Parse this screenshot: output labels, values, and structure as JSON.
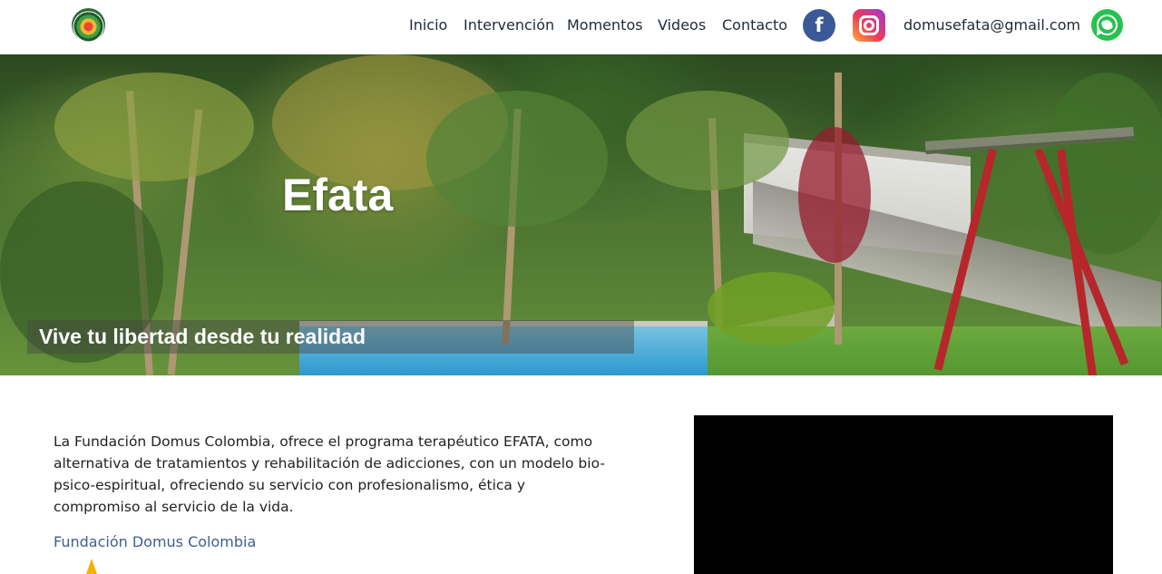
{
  "header": {
    "logo_icon": "domus-colombia-logo",
    "nav": [
      "Inicio",
      "Intervención",
      "Momentos",
      "Videos",
      "Contacto"
    ],
    "facebook_icon": "facebook-icon",
    "instagram_icon": "instagram-icon",
    "email": "domusefata@gmail.com",
    "whatsapp_icon": "whatsapp-icon",
    "colors": {
      "facebook": "#3b5998",
      "whatsapp": "#27c14f",
      "nav_text": "#1f2a36"
    }
  },
  "hero": {
    "title": "Efata",
    "tagline": "Vive tu libertad desde tu realidad"
  },
  "main": {
    "intro": "La Fundación Domus Colombia, ofrece el programa terapéutico EFATA, como alternativa de tratamientos y rehabilitación de adicciones, con un modelo bio-psico-espiritual, ofreciendo su servicio con profesionalismo, ética y compromiso al servicio de la vida.",
    "link": "Fundación Domus Colombia",
    "link_color": "#3e5f8f",
    "arrow_icon": "arrow-up-icon",
    "arrow_color": "#f2b300"
  }
}
